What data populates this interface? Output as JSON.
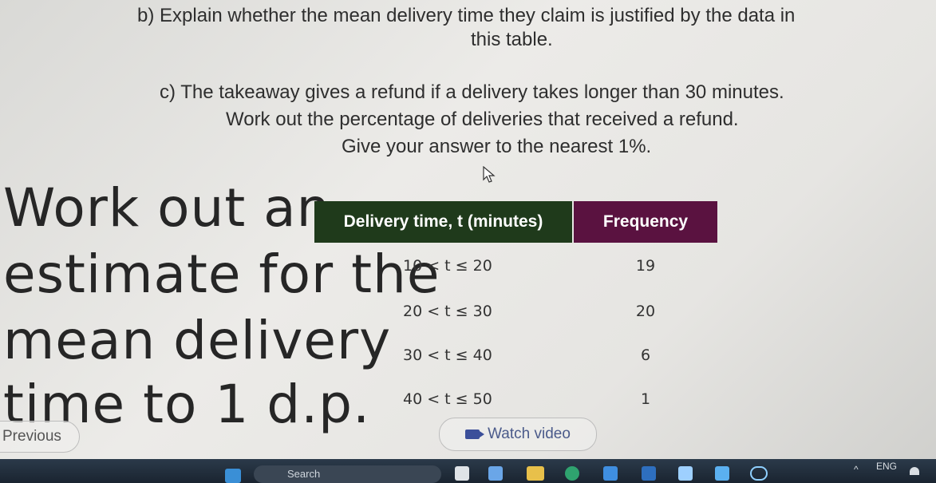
{
  "question": {
    "b_line1": "b) Explain whether the mean delivery time they claim is justified by the data in",
    "b_line2": "this table.",
    "c_line1": "c) The takeaway gives a refund if a delivery takes longer than 30 minutes.",
    "c_line2": "Work out the percentage of deliveries that received a refund.",
    "c_line3": "Give your answer to the nearest 1%."
  },
  "prompt": {
    "line1": "Work out an",
    "line2": "estimate for the",
    "line3": "mean delivery",
    "line4": "time to 1 d.p."
  },
  "table": {
    "headers": [
      "Delivery time, t (minutes)",
      "Frequency"
    ],
    "rows": [
      {
        "time": "10 < t ≤ 20",
        "frequency": "19"
      },
      {
        "time": "20 < t ≤ 30",
        "frequency": "20"
      },
      {
        "time": "30 < t ≤ 40",
        "frequency": "6"
      },
      {
        "time": "40 < t ≤ 50",
        "frequency": "1"
      }
    ]
  },
  "nav": {
    "previous_label": "Previous",
    "watch_label": "Watch video"
  },
  "taskbar": {
    "search_placeholder": "Search",
    "language": "ENG",
    "chevron": "^"
  },
  "colors": {
    "header_time": "#1f3a1b",
    "header_freq": "#5a1240"
  }
}
